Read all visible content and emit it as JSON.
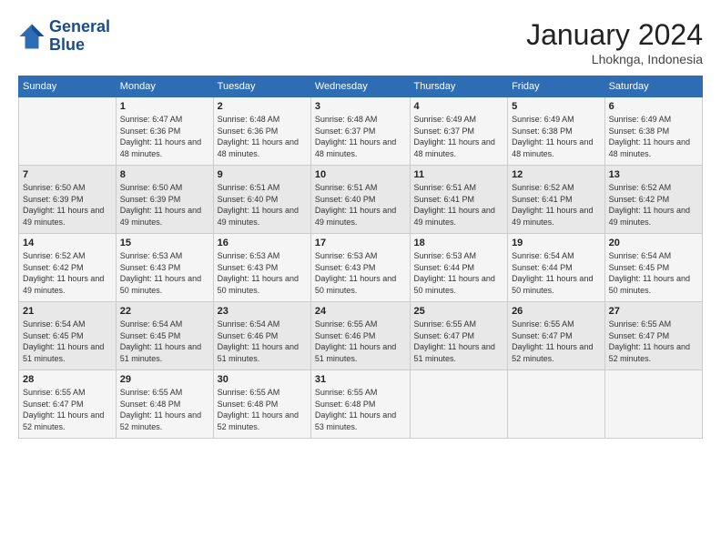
{
  "header": {
    "logo_line1": "General",
    "logo_line2": "Blue",
    "month": "January 2024",
    "location": "Lhoknga, Indonesia"
  },
  "weekdays": [
    "Sunday",
    "Monday",
    "Tuesday",
    "Wednesday",
    "Thursday",
    "Friday",
    "Saturday"
  ],
  "weeks": [
    [
      {
        "day": "",
        "sunrise": "",
        "sunset": "",
        "daylight": ""
      },
      {
        "day": "1",
        "sunrise": "Sunrise: 6:47 AM",
        "sunset": "Sunset: 6:36 PM",
        "daylight": "Daylight: 11 hours and 48 minutes."
      },
      {
        "day": "2",
        "sunrise": "Sunrise: 6:48 AM",
        "sunset": "Sunset: 6:36 PM",
        "daylight": "Daylight: 11 hours and 48 minutes."
      },
      {
        "day": "3",
        "sunrise": "Sunrise: 6:48 AM",
        "sunset": "Sunset: 6:37 PM",
        "daylight": "Daylight: 11 hours and 48 minutes."
      },
      {
        "day": "4",
        "sunrise": "Sunrise: 6:49 AM",
        "sunset": "Sunset: 6:37 PM",
        "daylight": "Daylight: 11 hours and 48 minutes."
      },
      {
        "day": "5",
        "sunrise": "Sunrise: 6:49 AM",
        "sunset": "Sunset: 6:38 PM",
        "daylight": "Daylight: 11 hours and 48 minutes."
      },
      {
        "day": "6",
        "sunrise": "Sunrise: 6:49 AM",
        "sunset": "Sunset: 6:38 PM",
        "daylight": "Daylight: 11 hours and 48 minutes."
      }
    ],
    [
      {
        "day": "7",
        "sunrise": "Sunrise: 6:50 AM",
        "sunset": "Sunset: 6:39 PM",
        "daylight": "Daylight: 11 hours and 49 minutes."
      },
      {
        "day": "8",
        "sunrise": "Sunrise: 6:50 AM",
        "sunset": "Sunset: 6:39 PM",
        "daylight": "Daylight: 11 hours and 49 minutes."
      },
      {
        "day": "9",
        "sunrise": "Sunrise: 6:51 AM",
        "sunset": "Sunset: 6:40 PM",
        "daylight": "Daylight: 11 hours and 49 minutes."
      },
      {
        "day": "10",
        "sunrise": "Sunrise: 6:51 AM",
        "sunset": "Sunset: 6:40 PM",
        "daylight": "Daylight: 11 hours and 49 minutes."
      },
      {
        "day": "11",
        "sunrise": "Sunrise: 6:51 AM",
        "sunset": "Sunset: 6:41 PM",
        "daylight": "Daylight: 11 hours and 49 minutes."
      },
      {
        "day": "12",
        "sunrise": "Sunrise: 6:52 AM",
        "sunset": "Sunset: 6:41 PM",
        "daylight": "Daylight: 11 hours and 49 minutes."
      },
      {
        "day": "13",
        "sunrise": "Sunrise: 6:52 AM",
        "sunset": "Sunset: 6:42 PM",
        "daylight": "Daylight: 11 hours and 49 minutes."
      }
    ],
    [
      {
        "day": "14",
        "sunrise": "Sunrise: 6:52 AM",
        "sunset": "Sunset: 6:42 PM",
        "daylight": "Daylight: 11 hours and 49 minutes."
      },
      {
        "day": "15",
        "sunrise": "Sunrise: 6:53 AM",
        "sunset": "Sunset: 6:43 PM",
        "daylight": "Daylight: 11 hours and 50 minutes."
      },
      {
        "day": "16",
        "sunrise": "Sunrise: 6:53 AM",
        "sunset": "Sunset: 6:43 PM",
        "daylight": "Daylight: 11 hours and 50 minutes."
      },
      {
        "day": "17",
        "sunrise": "Sunrise: 6:53 AM",
        "sunset": "Sunset: 6:43 PM",
        "daylight": "Daylight: 11 hours and 50 minutes."
      },
      {
        "day": "18",
        "sunrise": "Sunrise: 6:53 AM",
        "sunset": "Sunset: 6:44 PM",
        "daylight": "Daylight: 11 hours and 50 minutes."
      },
      {
        "day": "19",
        "sunrise": "Sunrise: 6:54 AM",
        "sunset": "Sunset: 6:44 PM",
        "daylight": "Daylight: 11 hours and 50 minutes."
      },
      {
        "day": "20",
        "sunrise": "Sunrise: 6:54 AM",
        "sunset": "Sunset: 6:45 PM",
        "daylight": "Daylight: 11 hours and 50 minutes."
      }
    ],
    [
      {
        "day": "21",
        "sunrise": "Sunrise: 6:54 AM",
        "sunset": "Sunset: 6:45 PM",
        "daylight": "Daylight: 11 hours and 51 minutes."
      },
      {
        "day": "22",
        "sunrise": "Sunrise: 6:54 AM",
        "sunset": "Sunset: 6:45 PM",
        "daylight": "Daylight: 11 hours and 51 minutes."
      },
      {
        "day": "23",
        "sunrise": "Sunrise: 6:54 AM",
        "sunset": "Sunset: 6:46 PM",
        "daylight": "Daylight: 11 hours and 51 minutes."
      },
      {
        "day": "24",
        "sunrise": "Sunrise: 6:55 AM",
        "sunset": "Sunset: 6:46 PM",
        "daylight": "Daylight: 11 hours and 51 minutes."
      },
      {
        "day": "25",
        "sunrise": "Sunrise: 6:55 AM",
        "sunset": "Sunset: 6:47 PM",
        "daylight": "Daylight: 11 hours and 51 minutes."
      },
      {
        "day": "26",
        "sunrise": "Sunrise: 6:55 AM",
        "sunset": "Sunset: 6:47 PM",
        "daylight": "Daylight: 11 hours and 52 minutes."
      },
      {
        "day": "27",
        "sunrise": "Sunrise: 6:55 AM",
        "sunset": "Sunset: 6:47 PM",
        "daylight": "Daylight: 11 hours and 52 minutes."
      }
    ],
    [
      {
        "day": "28",
        "sunrise": "Sunrise: 6:55 AM",
        "sunset": "Sunset: 6:47 PM",
        "daylight": "Daylight: 11 hours and 52 minutes."
      },
      {
        "day": "29",
        "sunrise": "Sunrise: 6:55 AM",
        "sunset": "Sunset: 6:48 PM",
        "daylight": "Daylight: 11 hours and 52 minutes."
      },
      {
        "day": "30",
        "sunrise": "Sunrise: 6:55 AM",
        "sunset": "Sunset: 6:48 PM",
        "daylight": "Daylight: 11 hours and 52 minutes."
      },
      {
        "day": "31",
        "sunrise": "Sunrise: 6:55 AM",
        "sunset": "Sunset: 6:48 PM",
        "daylight": "Daylight: 11 hours and 53 minutes."
      },
      {
        "day": "",
        "sunrise": "",
        "sunset": "",
        "daylight": ""
      },
      {
        "day": "",
        "sunrise": "",
        "sunset": "",
        "daylight": ""
      },
      {
        "day": "",
        "sunrise": "",
        "sunset": "",
        "daylight": ""
      }
    ]
  ]
}
